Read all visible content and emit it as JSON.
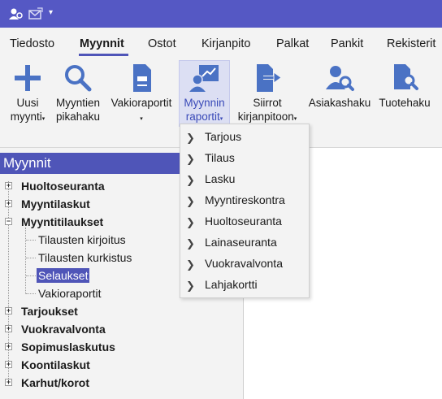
{
  "quick_access": {
    "icons": [
      "user-settings-icon",
      "mail-icon"
    ],
    "dropdown_glyph": "▾"
  },
  "menu": {
    "tabs": [
      "Tiedosto",
      "Myynnit",
      "Ostot",
      "Kirjanpito",
      "Palkat",
      "Pankit",
      "Rekisterit"
    ],
    "active": "Myynnit"
  },
  "ribbon": {
    "buttons": [
      {
        "line1": "Uusi",
        "line2": "myynti",
        "icon": "plus-icon"
      },
      {
        "line1": "Myyntien",
        "line2": "pikahaku",
        "icon": "magnifier-icon"
      },
      {
        "line1": "Vakioraportit",
        "line2": "",
        "icon": "report-icon"
      },
      {
        "line1": "Myynnin",
        "line2": "raportit",
        "icon": "sales-report-icon"
      },
      {
        "line1": "Siirrot",
        "line2": "kirjanpitoon",
        "icon": "transfer-icon"
      },
      {
        "line1": "Asiakashaku",
        "line2": "",
        "icon": "customer-search-icon"
      },
      {
        "line1": "Tuotehaku",
        "line2": "",
        "icon": "product-search-icon"
      }
    ]
  },
  "left_panel": {
    "title": "Myynnit",
    "tree": [
      {
        "label": "Huoltoseuranta",
        "level": 0,
        "expander": "+"
      },
      {
        "label": "Myyntilaskut",
        "level": 0,
        "expander": "+"
      },
      {
        "label": "Myyntitilaukset",
        "level": 0,
        "expander": "−"
      },
      {
        "label": "Tilausten kirjoitus",
        "level": 1
      },
      {
        "label": "Tilausten kurkistus",
        "level": 1
      },
      {
        "label": "Selaukset",
        "level": 1,
        "selected": true
      },
      {
        "label": "Vakioraportit",
        "level": 1
      },
      {
        "label": "Tarjoukset",
        "level": 0,
        "expander": "+"
      },
      {
        "label": "Vuokravalvonta",
        "level": 0,
        "expander": "+"
      },
      {
        "label": "Sopimuslaskutus",
        "level": 0,
        "expander": "+"
      },
      {
        "label": "Koontilaskut",
        "level": 0,
        "expander": "+"
      },
      {
        "label": "Karhut/korot",
        "level": 0,
        "expander": "+"
      }
    ]
  },
  "dropdown": {
    "items": [
      "Tarjous",
      "Tilaus",
      "Lasku",
      "Myyntireskontra",
      "Huoltoseuranta",
      "Lainaseuranta",
      "Vuokravalvonta",
      "Lahjakortti"
    ]
  },
  "colors": {
    "titlebar": "#5558c4",
    "accent": "#4f55b8",
    "ribbon_bg": "#f3f3f3",
    "icon_blue": "#4a72c4"
  }
}
